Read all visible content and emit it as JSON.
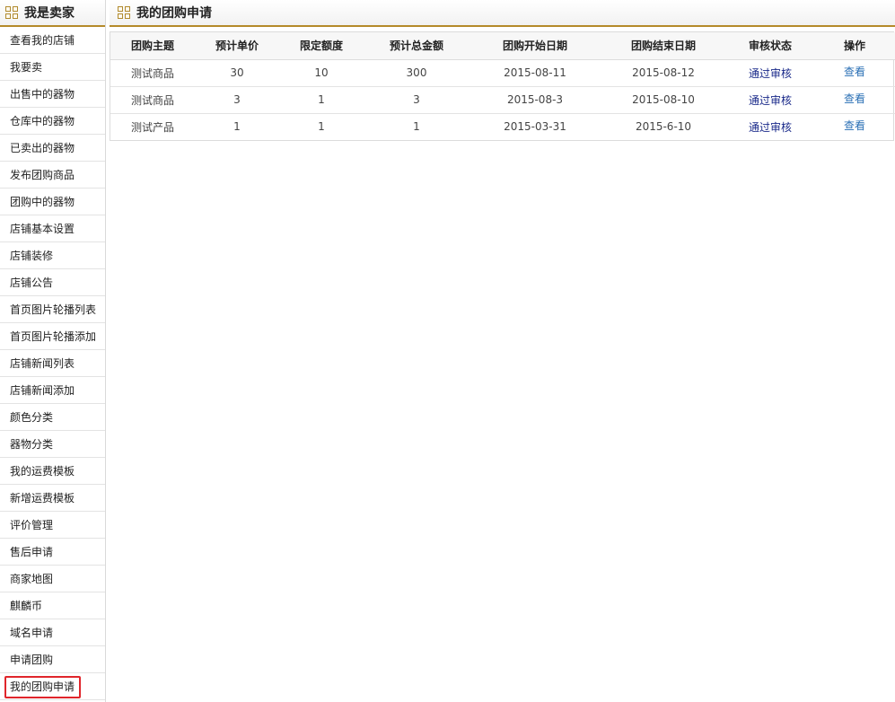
{
  "sidebar": {
    "title": "我是卖家",
    "items": [
      "查看我的店铺",
      "我要卖",
      "出售中的器物",
      "仓库中的器物",
      "已卖出的器物",
      "发布团购商品",
      "团购中的器物",
      "店铺基本设置",
      "店铺装修",
      "店铺公告",
      "首页图片轮播列表",
      "首页图片轮播添加",
      "店铺新闻列表",
      "店铺新闻添加",
      "颜色分类",
      "器物分类",
      "我的运费模板",
      "新增运费模板",
      "评价管理",
      "售后申请",
      "商家地图",
      "麒麟币",
      "域名申请",
      "申请团购",
      "我的团购申请"
    ],
    "active_index": 24
  },
  "main": {
    "title": "我的团购申请",
    "table": {
      "headers": [
        "团购主题",
        "预计单价",
        "限定额度",
        "预计总金额",
        "团购开始日期",
        "团购结束日期",
        "审核状态",
        "操作"
      ],
      "rows": [
        [
          "测试商品",
          "30",
          "10",
          "300",
          "2015-08-11",
          "2015-08-12",
          "通过审核",
          "查看"
        ],
        [
          "测试商品",
          "3",
          "1",
          "3",
          "2015-08-3",
          "2015-08-10",
          "通过审核",
          "查看"
        ],
        [
          "测试产品",
          "1",
          "1",
          "1",
          "2015-03-31",
          "2015-6-10",
          "通过审核",
          "查看"
        ]
      ]
    }
  },
  "colors": {
    "accent_border": "#b58a2a",
    "active_outline": "#e0252b",
    "status_link": "#1a2a8a",
    "view_link": "#2a6fb5"
  },
  "icons": {
    "header_icon": "grid-icon"
  }
}
